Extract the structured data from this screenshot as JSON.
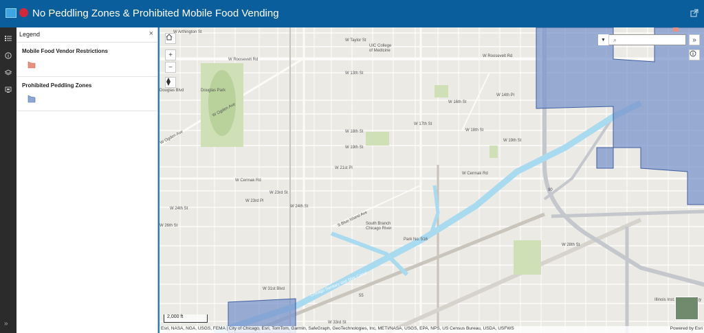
{
  "app": {
    "title": "No Peddling Zones & Prohibited Mobile Food Vending"
  },
  "rail": {
    "expand": "»"
  },
  "legend": {
    "title": "Legend",
    "close": "×",
    "layers": [
      {
        "label": "Mobile Food Vendor Restrictions",
        "swatch_color": "#e8907e"
      },
      {
        "label": "Prohibited Peddling Zones",
        "swatch_color": "#8aa7d6"
      }
    ]
  },
  "map": {
    "search_placeholder": "",
    "scale_label": "2,000 ft",
    "attribution": "Esri, NASA, NGA, USGS, FEMA | City of Chicago, Esri, TomTom, Garmin, SafeGraph, GeoTechnologies, Inc, METI/NASA, USGS, EPA, NPS, US Census Bureau, USDA, USFWS",
    "powered_by": "Powered by Esri",
    "zoom_in": "+",
    "zoom_out": "−",
    "expand_btn": "»",
    "labels": {
      "arthington": "W Arthington St",
      "taylor": "W Taylor St",
      "uic": "UIC College",
      "uic2": "of Medicine",
      "roosevelt": "W Roosevelt Rd",
      "roosevelt2": "W Roosevelt Rd",
      "douglas": "Douglas Park",
      "douglasblvd": "Douglas Blvd",
      "ogden": "W Ogden Ave",
      "ogden2": "W Ogden Ave",
      "w13": "W 13th St",
      "w14": "W 14th Pl",
      "w16": "W 16th St",
      "w17": "W 17th St",
      "w18": "W 18th St",
      "w18b": "W 18th St",
      "w19": "W 19th St",
      "w19b": "W 19th St",
      "w21": "W 21st Pl",
      "cermak": "W Cermak Rd",
      "cermak2": "W Cermak Rd",
      "w23": "W 23rd St",
      "w23b": "W 23rd Pl",
      "w24": "W 24th St",
      "w26": "W 26th St",
      "w28": "W 28th St",
      "w31": "W 31st Blvd",
      "w33": "W 33rd St",
      "bluerd": "S Blue Island Ave",
      "southbranch": "South Branch",
      "chicagoriver": "Chicago River",
      "canal": "Chicago Sanitary and Ship Canal",
      "parkno": "Park No. 516",
      "illinois": "Illinois Inst. of Technology",
      "i90": "90",
      "i55": "55"
    }
  }
}
